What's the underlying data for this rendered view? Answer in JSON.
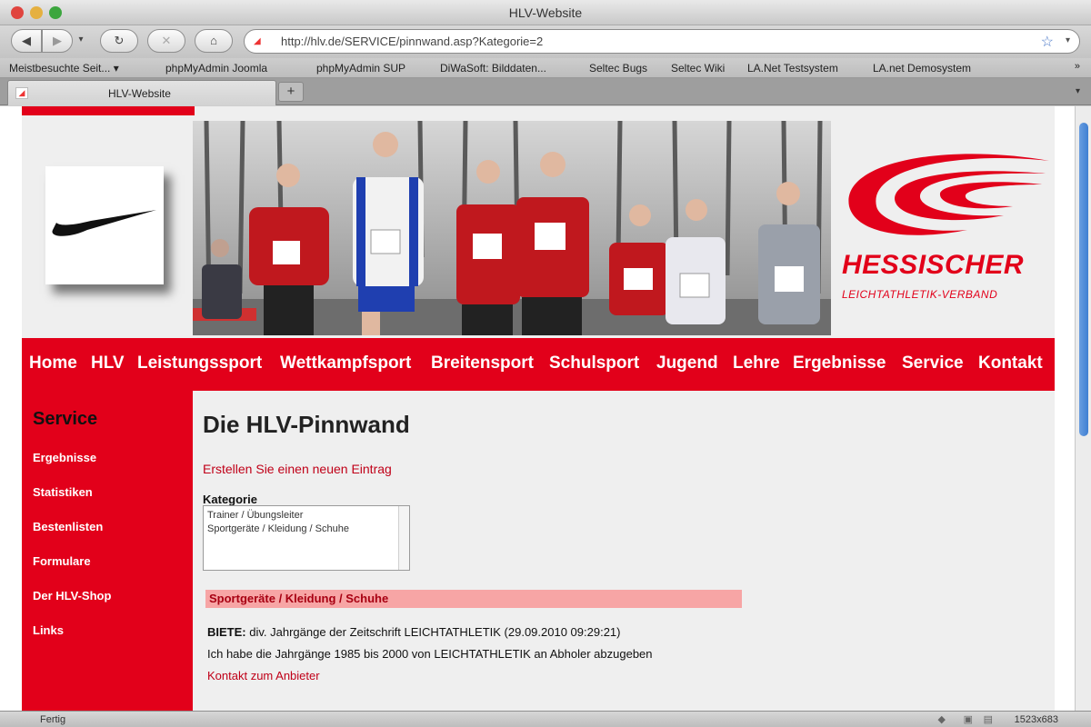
{
  "window": {
    "title": "HLV-Website"
  },
  "toolbar": {
    "back_symbol": "◀",
    "forward_symbol": "▶",
    "dropdown_symbol": "▾",
    "reload_symbol": "↻",
    "stop_symbol": "✕",
    "home_symbol": "⌂",
    "url": "http://hlv.de/SERVICE/pinnwand.asp?Kategorie=2",
    "star_symbol": "☆",
    "url_dropdown_symbol": "▾"
  },
  "bookmarks": {
    "items": [
      "Meistbesuchte Seit... ▾",
      "phpMyAdmin Joomla",
      "phpMyAdmin SUP",
      "DiWaSoft: Bilddaten...",
      "Seltec Bugs",
      "Seltec Wiki",
      "LA.Net Testsystem",
      "LA.net Demosystem"
    ],
    "overflow_symbol": "»"
  },
  "tabs": {
    "active_label": "HLV-Website",
    "add_symbol": "+",
    "list_symbol": "▾"
  },
  "header": {
    "verband_name": "HESSISCHER",
    "verband_sub": "LEICHTATHLETIK-VERBAND",
    "brand_red": "#e2001a"
  },
  "nav": {
    "items": [
      "Home",
      "HLV",
      "Leistungssport",
      "Wettkampfsport",
      "Breitensport",
      "Schulsport",
      "Jugend",
      "Lehre",
      "Ergebnisse",
      "Service",
      "Kontakt"
    ]
  },
  "sidebar": {
    "heading": "Service",
    "links": [
      "Ergebnisse",
      "Statistiken",
      "Bestenlisten",
      "Formulare",
      "Der HLV-Shop",
      "Links"
    ]
  },
  "main": {
    "title": "Die HLV-Pinnwand",
    "create_link": "Erstellen Sie einen neuen Eintrag",
    "category_label": "Kategorie",
    "category_options": [
      "Trainer / Übungsleiter",
      "Sportgeräte / Kleidung / Schuhe"
    ],
    "category_header": "Sportgeräte / Kleidung / Schuhe",
    "entry": {
      "prefix": "BIETE:",
      "subject": " div. Jahrgänge der Zeitschrift LEICHTATHLETIK (29.09.2010 09:29:21)",
      "body": "Ich habe die Jahrgänge 1985 bis 2000 von LEICHTATHLETIK an Abholer abzugeben",
      "contact_link": "Kontakt zum Anbieter"
    }
  },
  "status": {
    "text": "Fertig",
    "count": "1523x683"
  }
}
